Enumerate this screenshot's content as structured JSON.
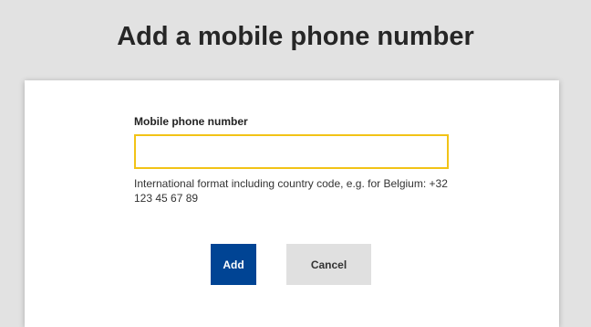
{
  "dialog": {
    "title": "Add a mobile phone number",
    "field_label": "Mobile phone number",
    "phone_value": "",
    "help_text": "International format including country code, e.g. for Belgium: +32 123 45 67 89",
    "add_label": "Add",
    "cancel_label": "Cancel"
  },
  "colors": {
    "primary": "#004494",
    "focus_border": "#f2c316",
    "secondary_button": "#e0e0e0",
    "background": "#e2e2e2"
  }
}
